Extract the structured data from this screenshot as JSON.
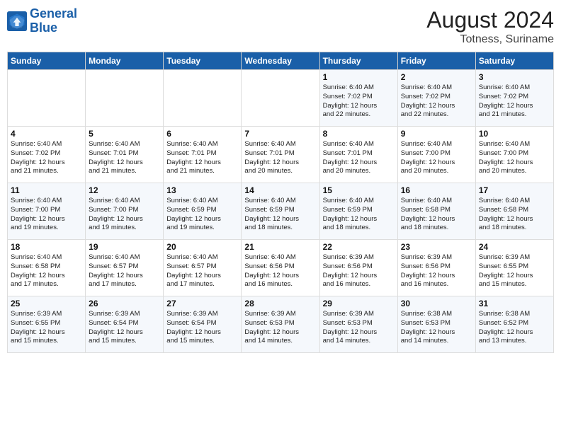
{
  "header": {
    "logo_line1": "General",
    "logo_line2": "Blue",
    "main_title": "August 2024",
    "subtitle": "Totness, Suriname"
  },
  "days_of_week": [
    "Sunday",
    "Monday",
    "Tuesday",
    "Wednesday",
    "Thursday",
    "Friday",
    "Saturday"
  ],
  "weeks": [
    [
      {
        "num": "",
        "info": ""
      },
      {
        "num": "",
        "info": ""
      },
      {
        "num": "",
        "info": ""
      },
      {
        "num": "",
        "info": ""
      },
      {
        "num": "1",
        "info": "Sunrise: 6:40 AM\nSunset: 7:02 PM\nDaylight: 12 hours\nand 22 minutes."
      },
      {
        "num": "2",
        "info": "Sunrise: 6:40 AM\nSunset: 7:02 PM\nDaylight: 12 hours\nand 22 minutes."
      },
      {
        "num": "3",
        "info": "Sunrise: 6:40 AM\nSunset: 7:02 PM\nDaylight: 12 hours\nand 21 minutes."
      }
    ],
    [
      {
        "num": "4",
        "info": "Sunrise: 6:40 AM\nSunset: 7:02 PM\nDaylight: 12 hours\nand 21 minutes."
      },
      {
        "num": "5",
        "info": "Sunrise: 6:40 AM\nSunset: 7:01 PM\nDaylight: 12 hours\nand 21 minutes."
      },
      {
        "num": "6",
        "info": "Sunrise: 6:40 AM\nSunset: 7:01 PM\nDaylight: 12 hours\nand 21 minutes."
      },
      {
        "num": "7",
        "info": "Sunrise: 6:40 AM\nSunset: 7:01 PM\nDaylight: 12 hours\nand 20 minutes."
      },
      {
        "num": "8",
        "info": "Sunrise: 6:40 AM\nSunset: 7:01 PM\nDaylight: 12 hours\nand 20 minutes."
      },
      {
        "num": "9",
        "info": "Sunrise: 6:40 AM\nSunset: 7:00 PM\nDaylight: 12 hours\nand 20 minutes."
      },
      {
        "num": "10",
        "info": "Sunrise: 6:40 AM\nSunset: 7:00 PM\nDaylight: 12 hours\nand 20 minutes."
      }
    ],
    [
      {
        "num": "11",
        "info": "Sunrise: 6:40 AM\nSunset: 7:00 PM\nDaylight: 12 hours\nand 19 minutes."
      },
      {
        "num": "12",
        "info": "Sunrise: 6:40 AM\nSunset: 7:00 PM\nDaylight: 12 hours\nand 19 minutes."
      },
      {
        "num": "13",
        "info": "Sunrise: 6:40 AM\nSunset: 6:59 PM\nDaylight: 12 hours\nand 19 minutes."
      },
      {
        "num": "14",
        "info": "Sunrise: 6:40 AM\nSunset: 6:59 PM\nDaylight: 12 hours\nand 18 minutes."
      },
      {
        "num": "15",
        "info": "Sunrise: 6:40 AM\nSunset: 6:59 PM\nDaylight: 12 hours\nand 18 minutes."
      },
      {
        "num": "16",
        "info": "Sunrise: 6:40 AM\nSunset: 6:58 PM\nDaylight: 12 hours\nand 18 minutes."
      },
      {
        "num": "17",
        "info": "Sunrise: 6:40 AM\nSunset: 6:58 PM\nDaylight: 12 hours\nand 18 minutes."
      }
    ],
    [
      {
        "num": "18",
        "info": "Sunrise: 6:40 AM\nSunset: 6:58 PM\nDaylight: 12 hours\nand 17 minutes."
      },
      {
        "num": "19",
        "info": "Sunrise: 6:40 AM\nSunset: 6:57 PM\nDaylight: 12 hours\nand 17 minutes."
      },
      {
        "num": "20",
        "info": "Sunrise: 6:40 AM\nSunset: 6:57 PM\nDaylight: 12 hours\nand 17 minutes."
      },
      {
        "num": "21",
        "info": "Sunrise: 6:40 AM\nSunset: 6:56 PM\nDaylight: 12 hours\nand 16 minutes."
      },
      {
        "num": "22",
        "info": "Sunrise: 6:39 AM\nSunset: 6:56 PM\nDaylight: 12 hours\nand 16 minutes."
      },
      {
        "num": "23",
        "info": "Sunrise: 6:39 AM\nSunset: 6:56 PM\nDaylight: 12 hours\nand 16 minutes."
      },
      {
        "num": "24",
        "info": "Sunrise: 6:39 AM\nSunset: 6:55 PM\nDaylight: 12 hours\nand 15 minutes."
      }
    ],
    [
      {
        "num": "25",
        "info": "Sunrise: 6:39 AM\nSunset: 6:55 PM\nDaylight: 12 hours\nand 15 minutes."
      },
      {
        "num": "26",
        "info": "Sunrise: 6:39 AM\nSunset: 6:54 PM\nDaylight: 12 hours\nand 15 minutes."
      },
      {
        "num": "27",
        "info": "Sunrise: 6:39 AM\nSunset: 6:54 PM\nDaylight: 12 hours\nand 15 minutes."
      },
      {
        "num": "28",
        "info": "Sunrise: 6:39 AM\nSunset: 6:53 PM\nDaylight: 12 hours\nand 14 minutes."
      },
      {
        "num": "29",
        "info": "Sunrise: 6:39 AM\nSunset: 6:53 PM\nDaylight: 12 hours\nand 14 minutes."
      },
      {
        "num": "30",
        "info": "Sunrise: 6:38 AM\nSunset: 6:53 PM\nDaylight: 12 hours\nand 14 minutes."
      },
      {
        "num": "31",
        "info": "Sunrise: 6:38 AM\nSunset: 6:52 PM\nDaylight: 12 hours\nand 13 minutes."
      }
    ]
  ]
}
